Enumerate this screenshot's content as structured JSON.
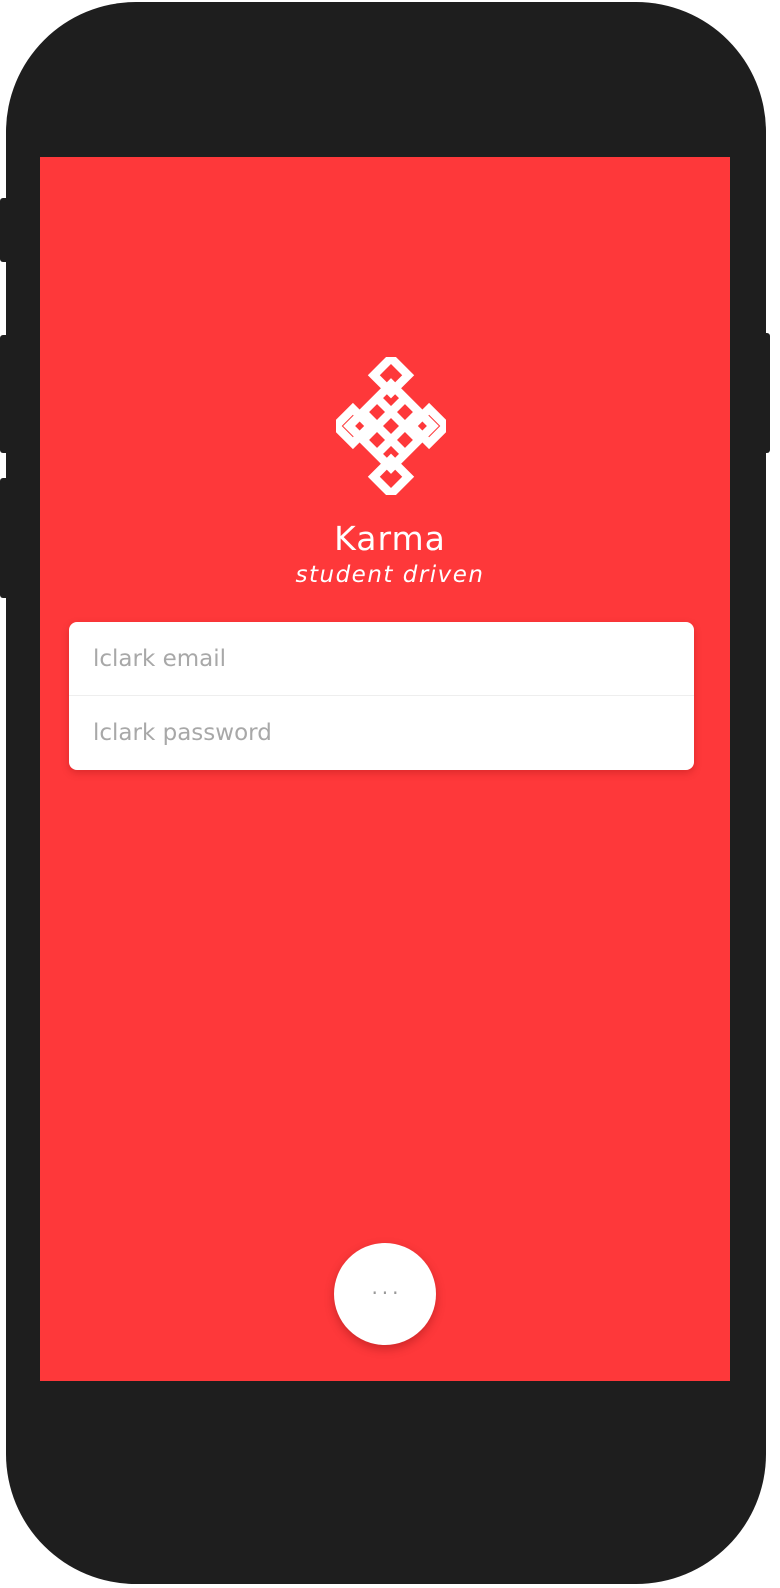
{
  "app": {
    "title": "Karma",
    "tagline": "student driven"
  },
  "login": {
    "email_placeholder": "lclark email",
    "email_value": "",
    "password_placeholder": "lclark password",
    "password_value": ""
  },
  "more_button": {
    "label": "···"
  },
  "icons": {
    "logo": "endless-knot-icon"
  },
  "colors": {
    "screen_background": "#fe383a",
    "phone_body": "#1e1e1e",
    "card_background": "#ffffff",
    "placeholder_text": "#a8a8a8"
  }
}
